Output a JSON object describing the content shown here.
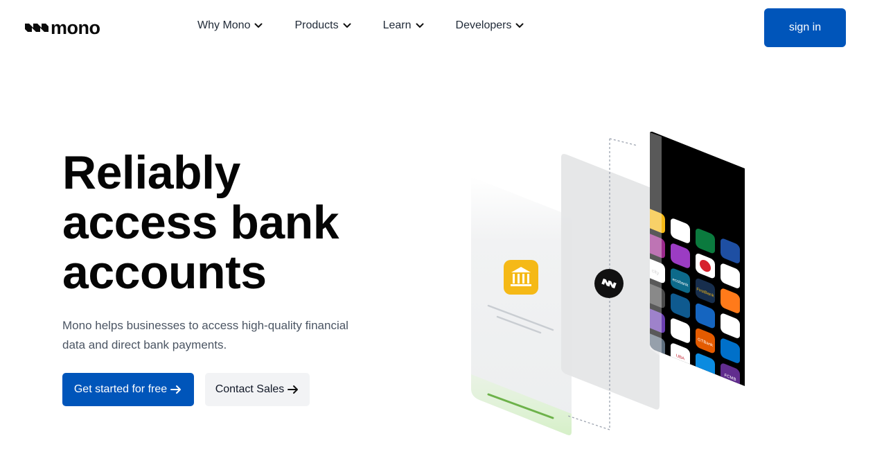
{
  "brand": {
    "name": "mono"
  },
  "nav": {
    "items": [
      {
        "label": "Why Mono",
        "icon": "chevron-down-icon"
      },
      {
        "label": "Products",
        "icon": "chevron-down-icon"
      },
      {
        "label": "Learn",
        "icon": "chevron-down-icon"
      },
      {
        "label": "Developers",
        "icon": "chevron-down-icon"
      }
    ],
    "signin_label": "sign in"
  },
  "hero": {
    "title_line1": "Reliably",
    "title_line2": "access bank",
    "title_line3": "accounts",
    "description": "Mono helps businesses to access high-quality financial data and direct bank payments.",
    "primary_cta": "Get started for free",
    "secondary_cta": "Contact Sales"
  },
  "illustration": {
    "bank_labels": [
      "FirstBank",
      "ecobank",
      "GTBank",
      "Jaiz",
      "UBA",
      "FCMB",
      "city"
    ]
  },
  "colors": {
    "primary": "#0055ba",
    "secondary_bg": "#f2f3f5",
    "bank_icon": "#f5b917",
    "success": "#6cc04a"
  }
}
